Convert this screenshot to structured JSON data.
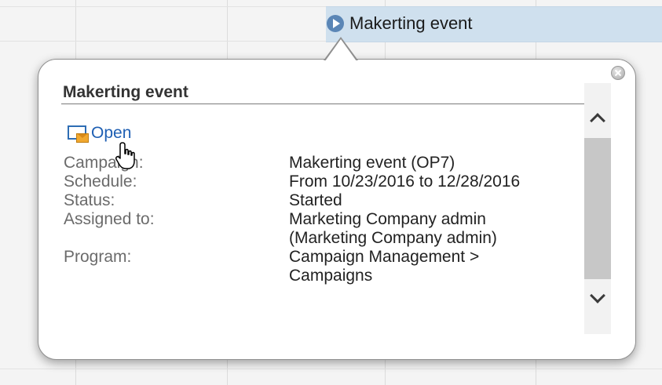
{
  "calendar": {
    "event_title": "Makerting event",
    "event_icon": "play-circle-icon",
    "event_color": "#cfe0ee"
  },
  "popup": {
    "title": "Makerting event",
    "open_label": "Open",
    "open_icon": "open-campaign-icon",
    "close_icon": "close-icon",
    "link_color": "#1e5fb3",
    "fields": [
      {
        "label": "Campaign:",
        "value_lines": [
          "Makerting event (OP7)"
        ]
      },
      {
        "label": "Schedule:",
        "value_lines": [
          "From 10/23/2016 to 12/28/2016"
        ]
      },
      {
        "label": "Status:",
        "value_lines": [
          "Started"
        ]
      },
      {
        "label": "Assigned to:",
        "value_lines": [
          "Marketing Company admin",
          "(Marketing Company admin)"
        ]
      },
      {
        "label": "Program:",
        "value_lines": [
          "Campaign Management >",
          "Campaigns"
        ]
      }
    ]
  },
  "scrollbar": {
    "up_icon": "chevron-up-icon",
    "down_icon": "chevron-down-icon"
  }
}
